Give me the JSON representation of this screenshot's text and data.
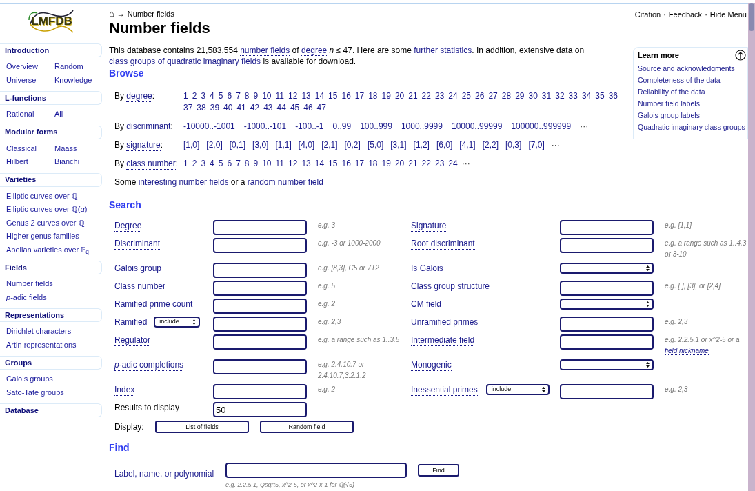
{
  "header": {
    "logo": "LMFDB",
    "home_icon": "⌂",
    "crumb_arrow": "→",
    "crumb": "Number fields",
    "title": "Number fields",
    "top_links": [
      "Citation",
      "Feedback",
      "Hide Menu"
    ],
    "separator": "·"
  },
  "sidebar": [
    {
      "title": "Introduction",
      "kind": "pairs",
      "items": [
        "Overview",
        "Random",
        "Universe",
        "Knowledge"
      ]
    },
    {
      "title": "L-functions",
      "kind": "pairs",
      "items": [
        "Rational",
        "All"
      ]
    },
    {
      "title": "Modular forms",
      "kind": "pairs",
      "items": [
        "Classical",
        "Maass",
        "Hilbert",
        "Bianchi"
      ]
    },
    {
      "title": "Varieties",
      "kind": "list",
      "items": [
        "Elliptic curves over ℚ",
        "Elliptic curves over ℚ(*α*)",
        "Genus 2 curves over ℚ",
        "Higher genus families",
        "Abelian varieties over 𝔽$_{q}$"
      ]
    },
    {
      "title": "Fields",
      "kind": "list",
      "items": [
        "Number fields",
        "*p*-adic fields"
      ]
    },
    {
      "title": "Representations",
      "kind": "list",
      "items": [
        "Dirichlet characters",
        "Artin representations"
      ]
    },
    {
      "title": "Groups",
      "kind": "list",
      "items": [
        "Galois groups",
        "Sato-Tate groups"
      ]
    },
    {
      "title": "Database"
    }
  ],
  "learn_more": {
    "title": "Learn more",
    "links": [
      "Source and acknowledgments",
      "Completeness of the data",
      "Reliability of the data",
      "Number field labels",
      "Galois group labels",
      "Quadratic imaginary class groups"
    ]
  },
  "intro": [
    {
      "kind": "plain",
      "text": "This database contains 21,583,554 "
    },
    {
      "kind": "knowl",
      "text": "number fields"
    },
    {
      "kind": "plain",
      "text": " of "
    },
    {
      "kind": "knowl",
      "text": "degree"
    },
    {
      "kind": "plain",
      "text": " *n* ≤ 47. Here are some "
    },
    {
      "kind": "link",
      "text": "further statistics"
    },
    {
      "kind": "plain",
      "text": ". In addition, extensive data on "
    },
    {
      "kind": "link",
      "text": "class groups of quadratic imaginary fields"
    },
    {
      "kind": "plain",
      "text": " is available for download."
    }
  ],
  "browse": {
    "title": "Browse",
    "rows": [
      {
        "kind": "numbers",
        "lead": "By",
        "knowl": "degree",
        "punct": ":",
        "values": [
          "1",
          "2",
          "3",
          "4",
          "5",
          "6",
          "7",
          "8",
          "9",
          "10",
          "11",
          "12",
          "13",
          "14",
          "15",
          "16",
          "17",
          "18",
          "19",
          "20",
          "21",
          "22",
          "23",
          "24",
          "25",
          "26",
          "27",
          "28",
          "29",
          "30",
          "31",
          "32",
          "33",
          "34",
          "35",
          "36",
          "37",
          "38",
          "39",
          "40",
          "41",
          "42",
          "43",
          "44",
          "45",
          "46",
          "47"
        ]
      },
      {
        "kind": "ranges",
        "lead": "By",
        "knowl": "discriminant",
        "punct": ":",
        "values": [
          "-10000..-1001",
          "-1000..-101",
          "-100..-1",
          "0..99",
          "100..999",
          "1000..9999",
          "10000..99999",
          "100000..999999"
        ],
        "more": "···"
      },
      {
        "kind": "pairs",
        "lead": "By",
        "knowl": "signature",
        "punct": ":",
        "values": [
          "[1,0]",
          "[2,0]",
          "[0,1]",
          "[3,0]",
          "[1,1]",
          "[4,0]",
          "[2,1]",
          "[0,2]",
          "[5,0]",
          "[3,1]",
          "[1,2]",
          "[6,0]",
          "[4,1]",
          "[2,2]",
          "[0,3]",
          "[7,0]"
        ],
        "more": "···"
      },
      {
        "kind": "numbers",
        "lead": "By",
        "knowl": "class number",
        "punct": ":",
        "values": [
          "1",
          "2",
          "3",
          "4",
          "5",
          "6",
          "7",
          "8",
          "9",
          "10",
          "11",
          "12",
          "13",
          "14",
          "15",
          "16",
          "17",
          "18",
          "19",
          "20",
          "21",
          "22",
          "23",
          "24"
        ],
        "more": "···"
      }
    ],
    "footer": [
      {
        "kind": "plain",
        "text": "Some "
      },
      {
        "kind": "link",
        "text": "interesting number fields"
      },
      {
        "kind": "plain",
        "text": " or a "
      },
      {
        "kind": "link",
        "text": "random number field"
      }
    ]
  },
  "search": {
    "title": "Search",
    "rows": [
      {
        "left": {
          "label": "Degree",
          "kind": "text",
          "hint": "e.g. 3"
        },
        "right": {
          "label": "Signature",
          "kind": "text",
          "hint": "e.g. [1,1]"
        }
      },
      {
        "left": {
          "label": "Discriminant",
          "kind": "text",
          "hint": "e.g. -3 or 1000-2000"
        },
        "right": {
          "label": "Root discriminant",
          "kind": "text",
          "hint": "e.g. a range such as 1..4.3 or 3-10"
        }
      },
      {
        "left": {
          "label": "Galois group",
          "kind": "text",
          "hint": "e.g. [8,3], C5 or 7T2"
        },
        "right": {
          "label": "Is Galois",
          "kind": "select"
        }
      },
      {
        "left": {
          "label": "Class number",
          "kind": "text",
          "hint": "e.g. 5"
        },
        "right": {
          "label": "Class group structure",
          "kind": "text",
          "hint": "e.g. [ ], [3], or [2,4]"
        }
      },
      {
        "left": {
          "label": "Ramified prime count",
          "kind": "text",
          "hint": "e.g. 2"
        },
        "right": {
          "label": "CM field",
          "kind": "select"
        }
      },
      {
        "left": {
          "label": "Ramified",
          "qualifier": "include",
          "kind": "text",
          "hint": "e.g. 2,3"
        },
        "right": {
          "label": "Unramified primes",
          "kind": "text",
          "hint": "e.g. 2,3"
        }
      },
      {
        "left": {
          "label": "Regulator",
          "kind": "text",
          "hint": "e.g. a range such as 1..3.5"
        },
        "right": {
          "label": "Intermediate field",
          "kind": "text",
          "hint": "e.g. 2.2.5.1 or x^2-5 or a ",
          "hint_link": "field nickname"
        }
      },
      {
        "left": {
          "label": "*p*-adic completions",
          "kind": "text",
          "hint": "e.g. 2.4.10.7 or 2.4.10.7,3.2.1.2"
        },
        "right": {
          "label": "Monogenic",
          "kind": "select"
        }
      },
      {
        "left": {
          "label": "Index",
          "kind": "text",
          "hint": "e.g. 2"
        },
        "right": {
          "label": "Inessential primes",
          "qualifier": "include",
          "kind": "text",
          "hint": "e.g. 2,3"
        }
      }
    ],
    "results": {
      "label": "Results to display",
      "value": "50"
    },
    "display": {
      "label": "Display:",
      "buttons": [
        "List of fields",
        "Random field"
      ]
    }
  },
  "find": {
    "title": "Find",
    "label": "Label, name, or polynomial",
    "button": "Find",
    "hint": "e.g. 2.2.5.1, Qsqrt5, x^2-5, or x^2-x-1 for ℚ(√5)"
  }
}
